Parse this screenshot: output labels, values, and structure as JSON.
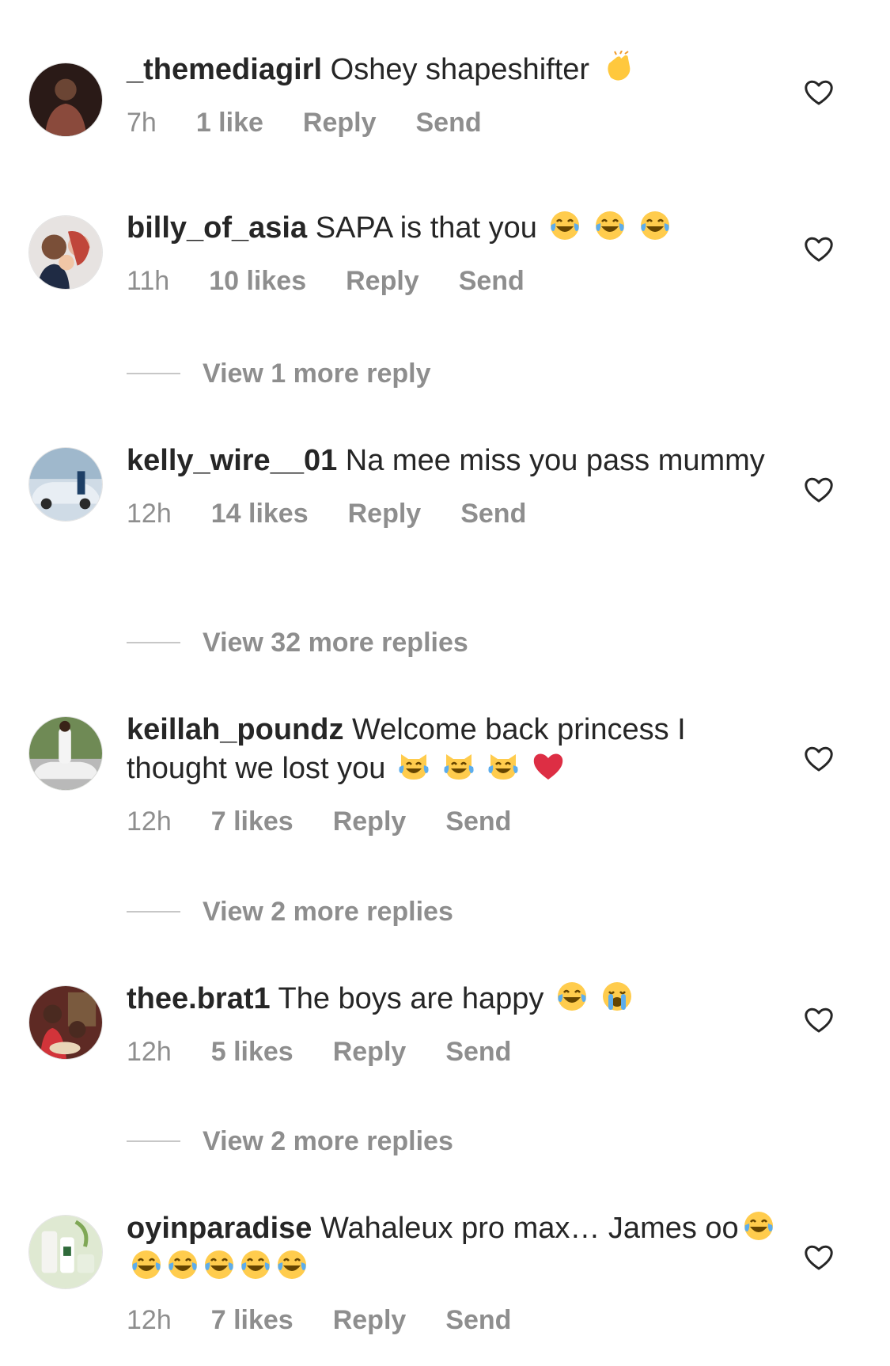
{
  "comments": [
    {
      "username": "_themediagirl",
      "text": "Oshey shapeshifter",
      "emojis": [
        "clapping-hands"
      ],
      "time": "7h",
      "likes": "1 like",
      "reply": "Reply",
      "send": "Send"
    },
    {
      "username": "billy_of_asia",
      "text": "SAPA is that you",
      "emojis": [
        "tears-of-joy",
        "tears-of-joy",
        "tears-of-joy"
      ],
      "time": "11h",
      "likes": "10 likes",
      "reply": "Reply",
      "send": "Send",
      "view_replies": "View 1 more reply"
    },
    {
      "username": "kelly_wire__01",
      "text": "Na mee miss you pass mummy",
      "emojis": [],
      "time": "12h",
      "likes": "14 likes",
      "reply": "Reply",
      "send": "Send",
      "view_replies": "View 32 more replies"
    },
    {
      "username": "keillah_poundz",
      "text": "Welcome back princess I thought we lost you",
      "emojis": [
        "cat-tears-of-joy",
        "cat-tears-of-joy",
        "cat-tears-of-joy",
        "red-heart"
      ],
      "time": "12h",
      "likes": "7 likes",
      "reply": "Reply",
      "send": "Send",
      "view_replies": "View 2 more replies"
    },
    {
      "username": "thee.brat1",
      "text": "The boys are happy",
      "emojis": [
        "tears-of-joy",
        "loudly-crying"
      ],
      "time": "12h",
      "likes": "5 likes",
      "reply": "Reply",
      "send": "Send",
      "view_replies": "View 2 more replies"
    },
    {
      "username": "oyinparadise",
      "text": "Wahaleux pro max… James oo",
      "emojis": [
        "tears-of-joy",
        "tears-of-joy",
        "tears-of-joy",
        "tears-of-joy",
        "tears-of-joy",
        "tears-of-joy"
      ],
      "time": "12h",
      "likes": "7 likes",
      "reply": "Reply",
      "send": "Send"
    }
  ],
  "icons": {
    "like": "heart-outline-icon"
  },
  "colors": {
    "text": "#262626",
    "secondary": "#8e8e8e",
    "divider": "#c7c7c7",
    "background": "#ffffff"
  }
}
